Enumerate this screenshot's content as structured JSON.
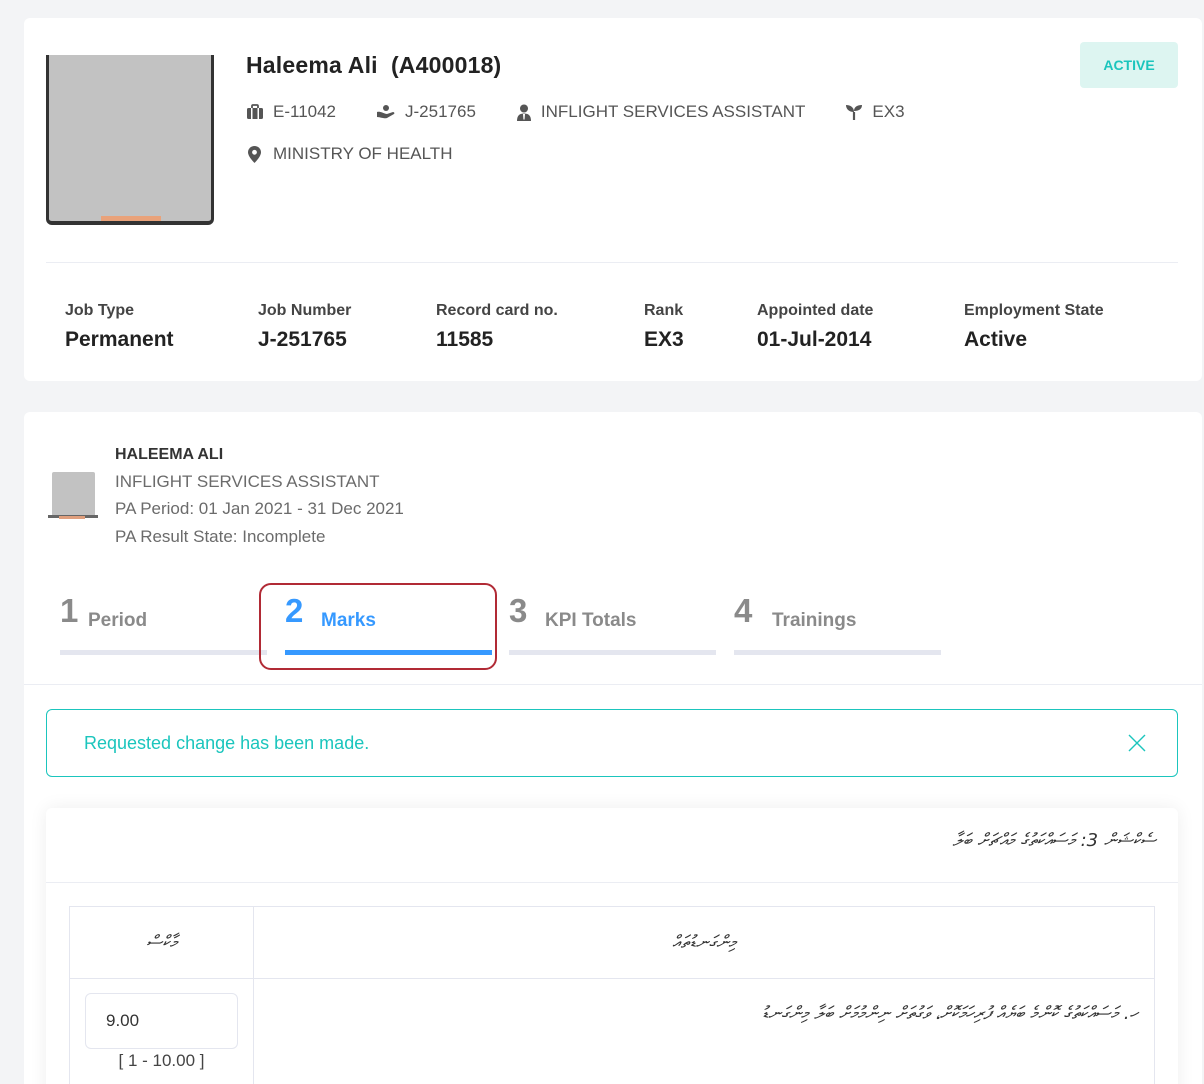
{
  "profile": {
    "name": "Haleema Ali",
    "id": "(A400018)",
    "status": "ACTIVE",
    "employee_no": "E-11042",
    "job_no": "J-251765",
    "designation": "INFLIGHT SERVICES ASSISTANT",
    "grade": "EX3",
    "office": "MINISTRY OF HEALTH",
    "info": [
      {
        "label": "Job Type",
        "value": "Permanent"
      },
      {
        "label": "Job Number",
        "value": "J-251765"
      },
      {
        "label": "Record card no.",
        "value": "11585"
      },
      {
        "label": "Rank",
        "value": "EX3"
      },
      {
        "label": "Appointed date",
        "value": "01-Jul-2014"
      },
      {
        "label": "Employment State",
        "value": "Active"
      }
    ]
  },
  "pa": {
    "name": "HALEEMA ALI",
    "designation": "INFLIGHT SERVICES ASSISTANT",
    "period": "PA Period: 01 Jan 2021 - 31 Dec 2021",
    "result_state": "PA Result State: Incomplete",
    "steps": [
      {
        "num": "1",
        "label": "Period"
      },
      {
        "num": "2",
        "label": "Marks"
      },
      {
        "num": "3",
        "label": "KPI Totals"
      },
      {
        "num": "4",
        "label": "Trainings"
      }
    ],
    "active_step": 2,
    "alert": "Requested change has been made.",
    "section_title": "ސެކްޝަން 3: މަސައްކަތުގެ މައްޗަށް ބަލާ",
    "table": {
      "col_marks": "މާކްސް",
      "col_criteria": "މިންގަނޑުތައް",
      "rows": [
        {
          "criteria": "ހ. މަސައްކަތުގެ ކޮންމެ ބަޔެއް ފުރިހަމަކޮށް، ވަގުތަށް ނިންމުމަށް ބަލާ މިންގަނޑު",
          "value": "9.00",
          "range": "[ 1 - 10.00 ]"
        }
      ]
    }
  },
  "colors": {
    "accent": "#3699ff",
    "success": "#1bc5bd",
    "highlight": "#b12a35"
  }
}
